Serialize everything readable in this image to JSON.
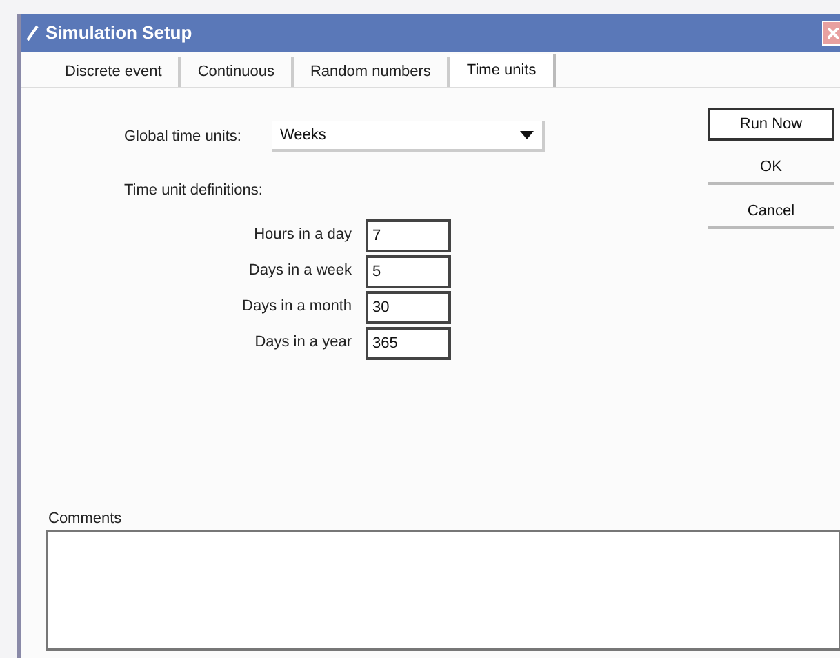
{
  "window": {
    "title": "Simulation Setup"
  },
  "tabs": [
    {
      "label": "Discrete event",
      "selected": false
    },
    {
      "label": "Continuous",
      "selected": false
    },
    {
      "label": "Random numbers",
      "selected": false
    },
    {
      "label": "Time units",
      "selected": true
    }
  ],
  "global_time_units": {
    "label": "Global time units:",
    "value": "Weeks"
  },
  "definitions": {
    "heading": "Time unit definitions:",
    "fields": [
      {
        "label": "Hours in a day",
        "value": "7"
      },
      {
        "label": "Days in a week",
        "value": "5"
      },
      {
        "label": "Days in a month",
        "value": "30"
      },
      {
        "label": "Days in a year",
        "value": "365"
      }
    ]
  },
  "buttons": [
    "Run Now",
    "OK",
    "Cancel"
  ],
  "comments": {
    "label": "Comments"
  }
}
